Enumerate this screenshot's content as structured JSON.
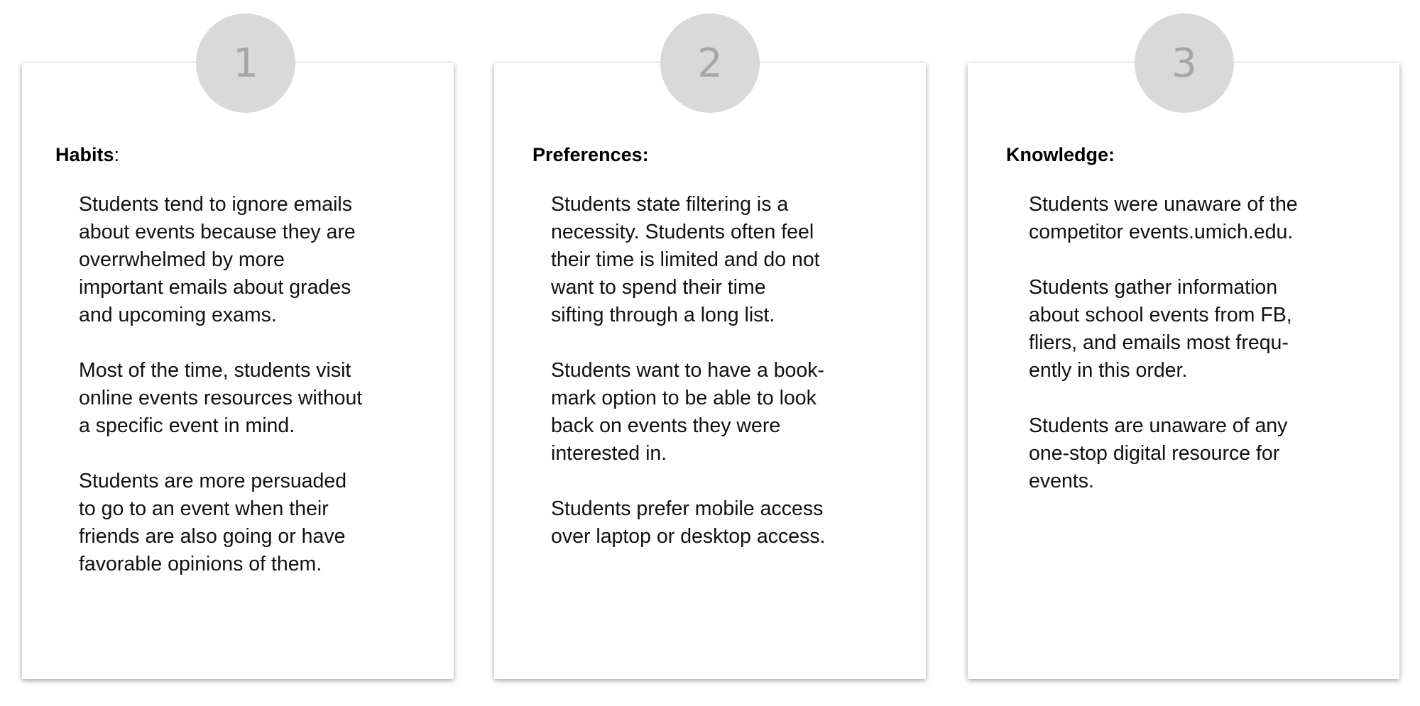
{
  "cards": [
    {
      "number": "1",
      "heading": "Habits",
      "heading_suffix": ":",
      "items": [
        "Students tend to ignore emails\nabout events because they are\noverrwhelmed by more\nimportant emails about grades\nand upcoming exams.",
        "Most of the time, students  visit\nonline events resources without\na specific event in mind.",
        "Students are more persuaded\nto go to an event when their\nfriends are also going or have\nfavorable opinions of them."
      ]
    },
    {
      "number": "2",
      "heading": "Preferences:",
      "heading_suffix": "",
      "items": [
        "Students state filtering is a\nnecessity. Students often feel\ntheir time is limited and do not\nwant to spend their time\nsifting through a long list.",
        "Students want to have a book-\nmark option to be able to look\nback on events they were\ninterested in.",
        "Students prefer mobile access\nover laptop or desktop access."
      ]
    },
    {
      "number": "3",
      "heading": "Knowledge:",
      "heading_suffix": "",
      "items": [
        "Students were unaware of the\ncompetitor events.umich.edu.",
        "Students gather information\nabout school events from FB,\nfliers, and emails most frequ-\nently in this order.",
        "Students are unaware of any\none-stop digital resource for\nevents."
      ]
    }
  ]
}
